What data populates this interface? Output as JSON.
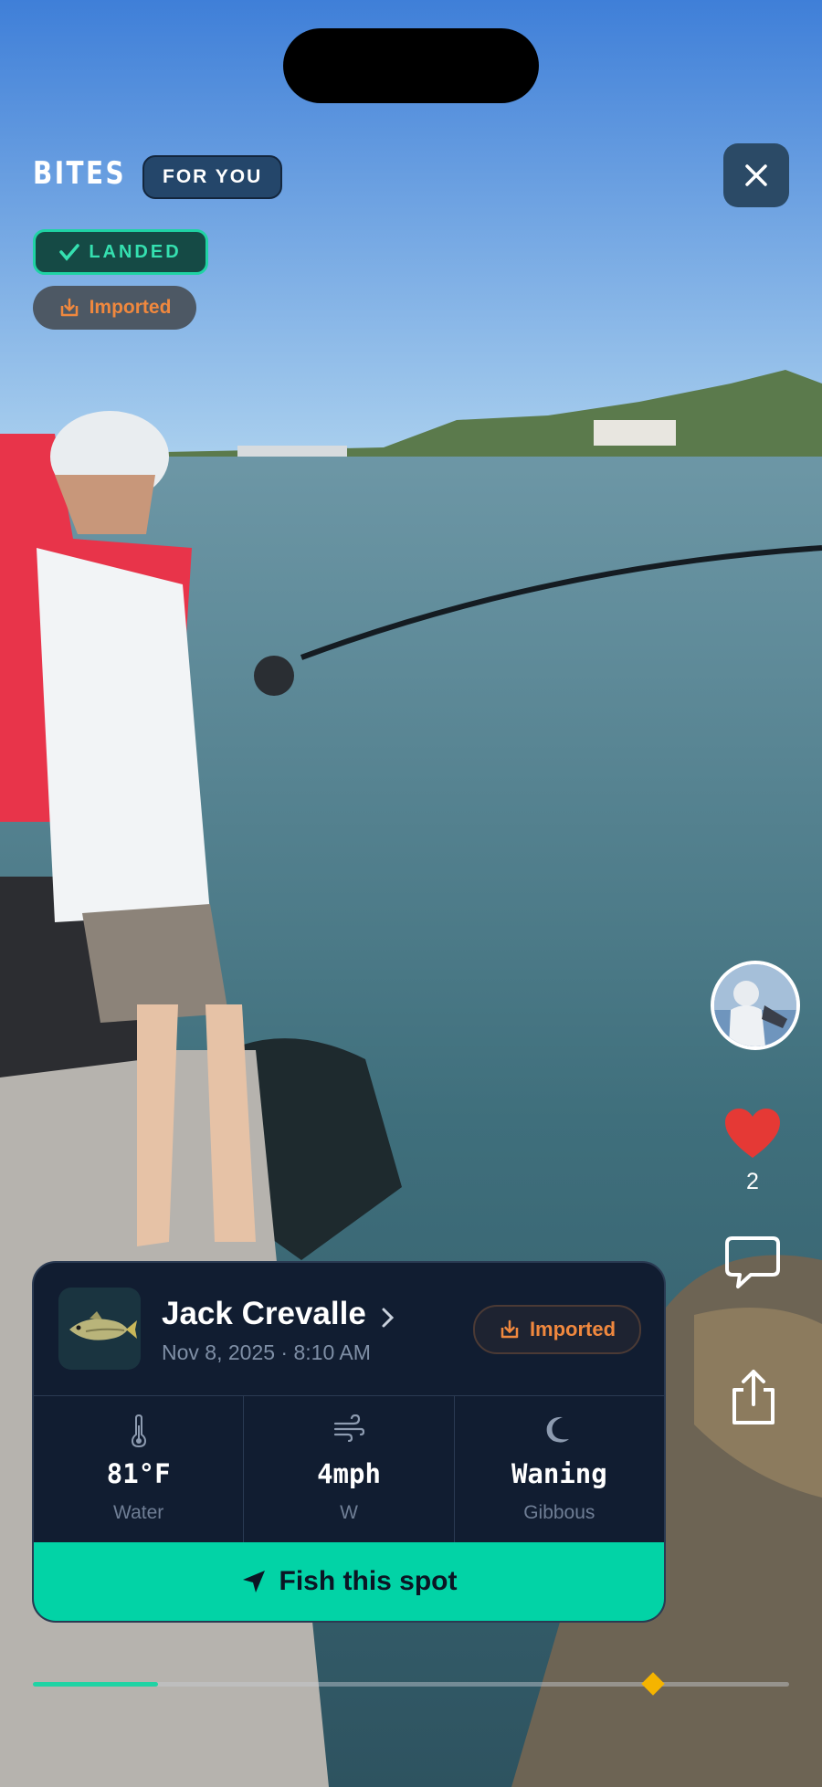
{
  "header": {
    "brand": "BITES",
    "feed_tab": "FOR YOU"
  },
  "badges": {
    "status": "LANDED",
    "source": "Imported"
  },
  "social": {
    "likes": "2"
  },
  "catch": {
    "species": "Jack Crevalle",
    "datetime": "Nov 8, 2025 · 8:10 AM",
    "badge": "Imported",
    "stats": [
      {
        "icon": "thermometer-icon",
        "value": "81°F",
        "label": "Water"
      },
      {
        "icon": "wind-icon",
        "value": "4mph",
        "label": "W"
      },
      {
        "icon": "moon-icon",
        "value": "Waning",
        "label": "Gibbous"
      }
    ],
    "cta": "Fish this spot"
  },
  "playback": {
    "progress": 0.165,
    "marker_position": 0.82
  },
  "colors": {
    "accent": "#02d3a6",
    "imported": "#f0883e",
    "like": "#e53935",
    "card": "#111d31"
  }
}
